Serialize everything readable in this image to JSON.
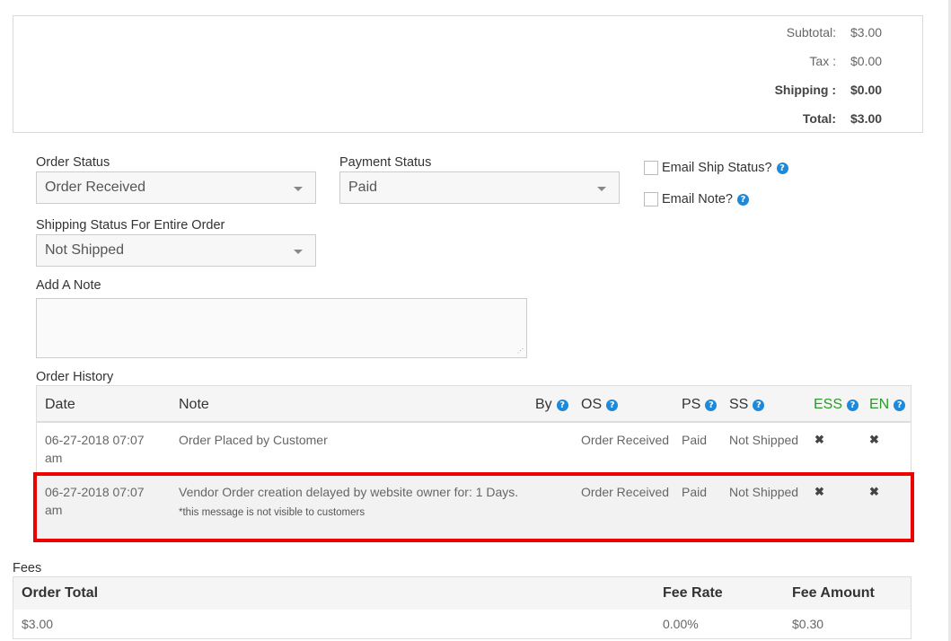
{
  "totals": {
    "subtotal_label": "Subtotal:",
    "subtotal_value": "$3.00",
    "tax_label": "Tax :",
    "tax_value": "$0.00",
    "shipping_label": "Shipping :",
    "shipping_value": "$0.00",
    "total_label": "Total:",
    "total_value": "$3.00"
  },
  "form": {
    "order_status_label": "Order Status",
    "order_status_value": "Order Received",
    "payment_status_label": "Payment Status",
    "payment_status_value": "Paid",
    "shipping_status_label": "Shipping Status For Entire Order",
    "shipping_status_value": "Not Shipped",
    "email_ship_status_label": "Email Ship Status?",
    "email_note_label": "Email Note?",
    "add_note_label": "Add A Note",
    "note_value": ""
  },
  "history": {
    "title": "Order History",
    "headers": {
      "date": "Date",
      "note": "Note",
      "by": "By",
      "os": "OS",
      "ps": "PS",
      "ss": "SS",
      "ess": "ESS",
      "en": "EN"
    },
    "rows": [
      {
        "date_line1": "06-27-2018 07:07",
        "date_line2": "am",
        "note": "Order Placed by Customer",
        "sub_note": "",
        "os": "Order Received",
        "ps": "Paid",
        "ss": "Not Shipped",
        "ess": "✖",
        "en": "✖"
      },
      {
        "date_line1": "06-27-2018 07:07",
        "date_line2": "am",
        "note": "Vendor Order creation delayed by website owner for: 1 Days.",
        "sub_note": "*this message is not visible to customers",
        "os": "Order Received",
        "ps": "Paid",
        "ss": "Not Shipped",
        "ess": "✖",
        "en": "✖"
      }
    ]
  },
  "fees": {
    "title": "Fees",
    "headers": {
      "order_total": "Order Total",
      "fee_rate": "Fee Rate",
      "fee_amount": "Fee Amount"
    },
    "row": {
      "order_total": "$3.00",
      "fee_rate": "0.00%",
      "fee_amount": "$0.30"
    }
  },
  "colors": {
    "highlight": "#e00000",
    "help_icon": "#1e88d9",
    "green_header": "#2a9a2a"
  }
}
